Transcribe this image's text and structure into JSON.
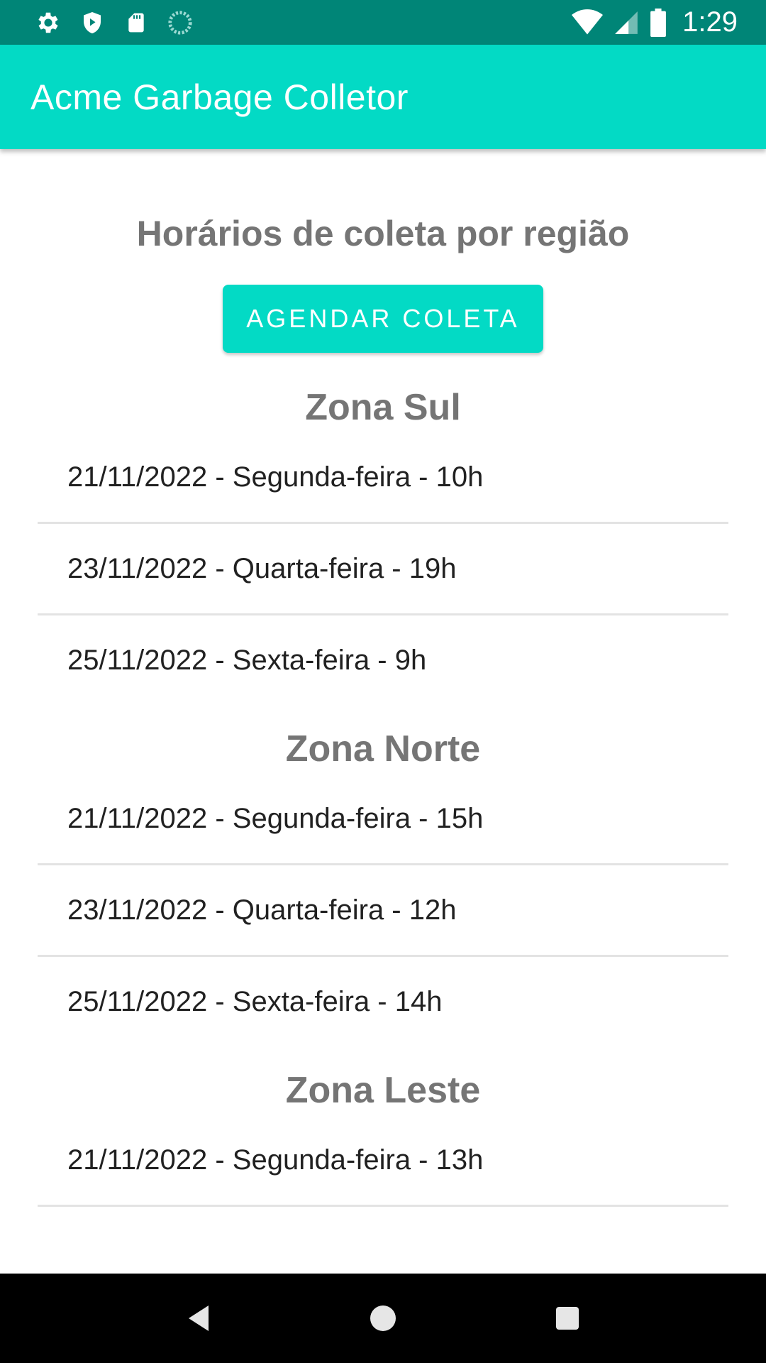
{
  "status_bar": {
    "time": "1:29",
    "left_icons": [
      "settings-icon",
      "shield-icon",
      "sd-card-icon",
      "sync-icon"
    ],
    "right_icons": [
      "wifi-icon",
      "signal-icon",
      "battery-icon"
    ]
  },
  "app_bar": {
    "title": "Acme Garbage Colletor",
    "color": "#03DAC5"
  },
  "main": {
    "headline": "Horários de coleta por região",
    "cta_label": "AGENDAR COLETA",
    "zones": [
      {
        "name": "Zona Sul",
        "schedules": [
          "21/11/2022 - Segunda-feira - 10h",
          "23/11/2022 - Quarta-feira - 19h",
          "25/11/2022 - Sexta-feira - 9h"
        ]
      },
      {
        "name": "Zona Norte",
        "schedules": [
          "21/11/2022 - Segunda-feira - 15h",
          "23/11/2022 - Quarta-feira - 12h",
          "25/11/2022 - Sexta-feira - 14h"
        ]
      },
      {
        "name": "Zona Leste",
        "schedules": [
          "21/11/2022 - Segunda-feira - 13h"
        ]
      }
    ]
  },
  "nav_bar": {
    "buttons": [
      "back-icon",
      "home-icon",
      "recents-icon"
    ]
  }
}
